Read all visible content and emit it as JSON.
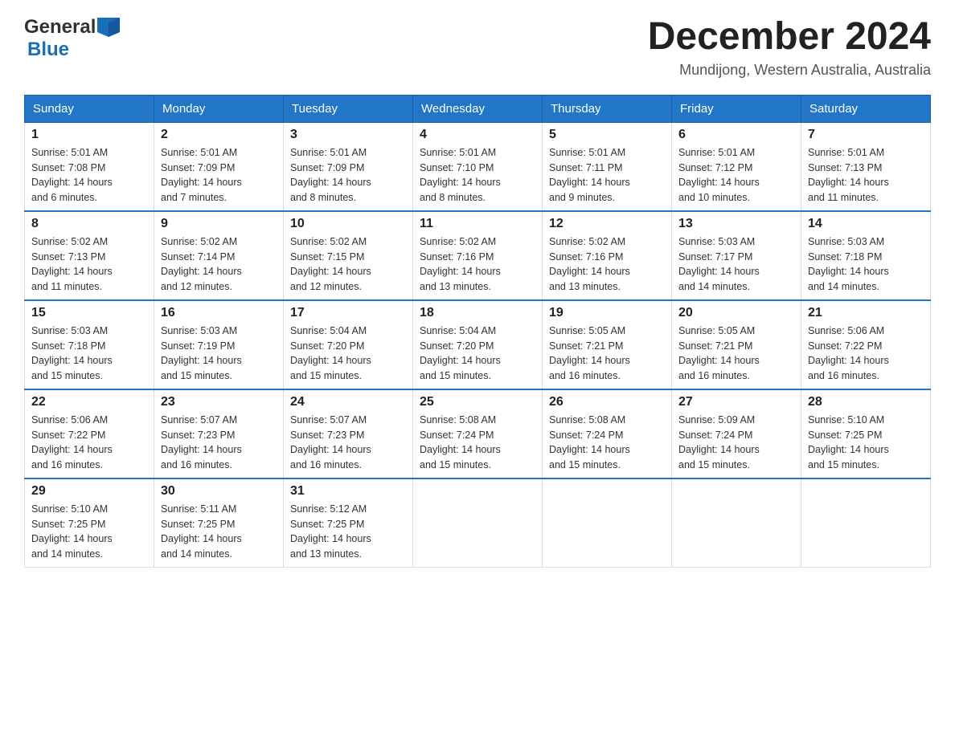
{
  "header": {
    "logo_general": "General",
    "logo_blue": "Blue",
    "month_title": "December 2024",
    "location": "Mundijong, Western Australia, Australia"
  },
  "calendar": {
    "days_of_week": [
      "Sunday",
      "Monday",
      "Tuesday",
      "Wednesday",
      "Thursday",
      "Friday",
      "Saturday"
    ],
    "weeks": [
      [
        {
          "day": "1",
          "sunrise": "5:01 AM",
          "sunset": "7:08 PM",
          "daylight": "14 hours and 6 minutes."
        },
        {
          "day": "2",
          "sunrise": "5:01 AM",
          "sunset": "7:09 PM",
          "daylight": "14 hours and 7 minutes."
        },
        {
          "day": "3",
          "sunrise": "5:01 AM",
          "sunset": "7:09 PM",
          "daylight": "14 hours and 8 minutes."
        },
        {
          "day": "4",
          "sunrise": "5:01 AM",
          "sunset": "7:10 PM",
          "daylight": "14 hours and 8 minutes."
        },
        {
          "day": "5",
          "sunrise": "5:01 AM",
          "sunset": "7:11 PM",
          "daylight": "14 hours and 9 minutes."
        },
        {
          "day": "6",
          "sunrise": "5:01 AM",
          "sunset": "7:12 PM",
          "daylight": "14 hours and 10 minutes."
        },
        {
          "day": "7",
          "sunrise": "5:01 AM",
          "sunset": "7:13 PM",
          "daylight": "14 hours and 11 minutes."
        }
      ],
      [
        {
          "day": "8",
          "sunrise": "5:02 AM",
          "sunset": "7:13 PM",
          "daylight": "14 hours and 11 minutes."
        },
        {
          "day": "9",
          "sunrise": "5:02 AM",
          "sunset": "7:14 PM",
          "daylight": "14 hours and 12 minutes."
        },
        {
          "day": "10",
          "sunrise": "5:02 AM",
          "sunset": "7:15 PM",
          "daylight": "14 hours and 12 minutes."
        },
        {
          "day": "11",
          "sunrise": "5:02 AM",
          "sunset": "7:16 PM",
          "daylight": "14 hours and 13 minutes."
        },
        {
          "day": "12",
          "sunrise": "5:02 AM",
          "sunset": "7:16 PM",
          "daylight": "14 hours and 13 minutes."
        },
        {
          "day": "13",
          "sunrise": "5:03 AM",
          "sunset": "7:17 PM",
          "daylight": "14 hours and 14 minutes."
        },
        {
          "day": "14",
          "sunrise": "5:03 AM",
          "sunset": "7:18 PM",
          "daylight": "14 hours and 14 minutes."
        }
      ],
      [
        {
          "day": "15",
          "sunrise": "5:03 AM",
          "sunset": "7:18 PM",
          "daylight": "14 hours and 15 minutes."
        },
        {
          "day": "16",
          "sunrise": "5:03 AM",
          "sunset": "7:19 PM",
          "daylight": "14 hours and 15 minutes."
        },
        {
          "day": "17",
          "sunrise": "5:04 AM",
          "sunset": "7:20 PM",
          "daylight": "14 hours and 15 minutes."
        },
        {
          "day": "18",
          "sunrise": "5:04 AM",
          "sunset": "7:20 PM",
          "daylight": "14 hours and 15 minutes."
        },
        {
          "day": "19",
          "sunrise": "5:05 AM",
          "sunset": "7:21 PM",
          "daylight": "14 hours and 16 minutes."
        },
        {
          "day": "20",
          "sunrise": "5:05 AM",
          "sunset": "7:21 PM",
          "daylight": "14 hours and 16 minutes."
        },
        {
          "day": "21",
          "sunrise": "5:06 AM",
          "sunset": "7:22 PM",
          "daylight": "14 hours and 16 minutes."
        }
      ],
      [
        {
          "day": "22",
          "sunrise": "5:06 AM",
          "sunset": "7:22 PM",
          "daylight": "14 hours and 16 minutes."
        },
        {
          "day": "23",
          "sunrise": "5:07 AM",
          "sunset": "7:23 PM",
          "daylight": "14 hours and 16 minutes."
        },
        {
          "day": "24",
          "sunrise": "5:07 AM",
          "sunset": "7:23 PM",
          "daylight": "14 hours and 16 minutes."
        },
        {
          "day": "25",
          "sunrise": "5:08 AM",
          "sunset": "7:24 PM",
          "daylight": "14 hours and 15 minutes."
        },
        {
          "day": "26",
          "sunrise": "5:08 AM",
          "sunset": "7:24 PM",
          "daylight": "14 hours and 15 minutes."
        },
        {
          "day": "27",
          "sunrise": "5:09 AM",
          "sunset": "7:24 PM",
          "daylight": "14 hours and 15 minutes."
        },
        {
          "day": "28",
          "sunrise": "5:10 AM",
          "sunset": "7:25 PM",
          "daylight": "14 hours and 15 minutes."
        }
      ],
      [
        {
          "day": "29",
          "sunrise": "5:10 AM",
          "sunset": "7:25 PM",
          "daylight": "14 hours and 14 minutes."
        },
        {
          "day": "30",
          "sunrise": "5:11 AM",
          "sunset": "7:25 PM",
          "daylight": "14 hours and 14 minutes."
        },
        {
          "day": "31",
          "sunrise": "5:12 AM",
          "sunset": "7:25 PM",
          "daylight": "14 hours and 13 minutes."
        },
        null,
        null,
        null,
        null
      ]
    ]
  },
  "labels": {
    "sunrise": "Sunrise:",
    "sunset": "Sunset:",
    "daylight": "Daylight:"
  }
}
